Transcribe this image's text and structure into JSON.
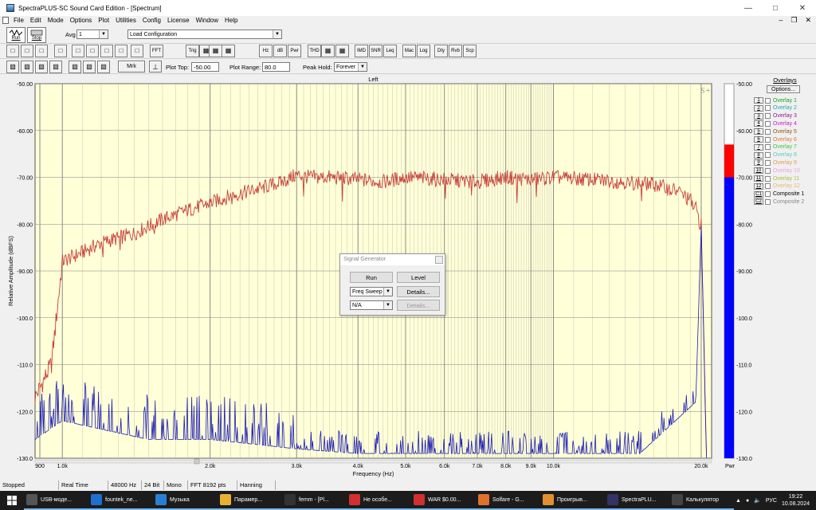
{
  "title": "SpectraPLUS-SC Sound Card Edition - [Spectrum]",
  "menu": [
    "File",
    "Edit",
    "Mode",
    "Options",
    "Plot",
    "Utilities",
    "Config",
    "License",
    "Window",
    "Help"
  ],
  "toolbar1": {
    "run": "Run",
    "stop": "Stop",
    "avg_label": "Avg",
    "avg_value": "1",
    "config_value": "Load Configuration"
  },
  "toolbar2": [
    "FFT",
    "Trig",
    "Hz",
    "dB",
    "Pwr",
    "THD",
    "IMD",
    "SNR",
    "Leq",
    "Mac",
    "Log",
    "Dty",
    "Rvb",
    "Scp"
  ],
  "toolbar3": {
    "mrk": "Mrk",
    "plot_top_label": "Plot Top:",
    "plot_top": "-50.00",
    "plot_range_label": "Plot Range:",
    "plot_range": "80.0",
    "peak_hold_label": "Peak Hold:",
    "peak_hold": "Forever"
  },
  "plot": {
    "title": "Left",
    "ylabel": "Relative Amplitude (dBFS)",
    "xlabel": "Frequency (Hz)",
    "logo": "S+",
    "bar_label": "Pwr",
    "yticks": [
      "-50.00",
      "-60.00",
      "-70.00",
      "-80.00",
      "-90.00",
      "-100.0",
      "-110.0",
      "-120.0",
      "-130.0"
    ],
    "ytick_values": [
      -50,
      -60,
      -70,
      -80,
      -90,
      -100,
      -110,
      -120,
      -130
    ],
    "xticks": [
      {
        "f": 900,
        "l": "900"
      },
      {
        "f": 1000,
        "l": "1.0k"
      },
      {
        "f": 2000,
        "l": "2.0k"
      },
      {
        "f": 3000,
        "l": "3.0k"
      },
      {
        "f": 4000,
        "l": "4.0k"
      },
      {
        "f": 5000,
        "l": "5.0k"
      },
      {
        "f": 6000,
        "l": "6.0k"
      },
      {
        "f": 7000,
        "l": "7.0k"
      },
      {
        "f": 8000,
        "l": "8.0k"
      },
      {
        "f": 9000,
        "l": "9.0k"
      },
      {
        "f": 10000,
        "l": "10.0k"
      },
      {
        "f": 20000,
        "l": "20.0k"
      }
    ],
    "colors": {
      "bg": "#ffffd8",
      "red": "#c8413a",
      "blue": "#1c1cb4",
      "grid": "#808080"
    },
    "bar_values": {
      "red_top": -63,
      "blue_top": -70
    }
  },
  "chart_data": {
    "type": "line",
    "title": "Left",
    "xlabel": "Frequency (Hz)",
    "ylabel": "Relative Amplitude (dBFS)",
    "xlim": [
      880,
      21000
    ],
    "ylim": [
      -130,
      -50
    ],
    "xscale": "log",
    "grid": true,
    "series": [
      {
        "x": [
          880,
          900,
          950,
          1000,
          1100,
          1200,
          1400,
          1600,
          1800,
          2000,
          2200,
          2500,
          2800,
          3000,
          3200,
          3500,
          4000,
          4500,
          5000,
          6000,
          7000,
          8000,
          9000,
          10000,
          12000,
          14000,
          16000,
          18000,
          19000,
          19500,
          20000,
          20500
        ],
        "y": [
          -117,
          -115,
          -110,
          -88,
          -86,
          -84,
          -82,
          -79,
          -77,
          -75.5,
          -74,
          -72.5,
          -71,
          -69.5,
          -70,
          -70,
          -70.5,
          -71,
          -70,
          -70.5,
          -71,
          -70,
          -70.5,
          -70,
          -70.5,
          -71,
          -71.5,
          -73,
          -75,
          -77,
          -80,
          -130
        ]
      },
      {
        "x": [
          880,
          1000,
          1500,
          2000,
          3000,
          4000,
          6000,
          8000,
          10000,
          15000,
          19500,
          20000,
          20500
        ],
        "y": [
          -126,
          -122,
          -126,
          -126,
          -128,
          -129,
          -129,
          -129,
          -129,
          -129,
          -118,
          -80,
          -130
        ]
      }
    ]
  },
  "dialog": {
    "title": "Signal Generator",
    "run": "Run",
    "level": "Level",
    "mode": "Freq Sweep",
    "details": "Details...",
    "na": "N/A"
  },
  "overlays": {
    "header": "Overlays",
    "options": "Options...",
    "items": [
      {
        "n": "1",
        "l": "Overlay 1",
        "c": "#1ea01e"
      },
      {
        "n": "2",
        "l": "Overlay 2",
        "c": "#29a8a8"
      },
      {
        "n": "3",
        "l": "Overlay 3",
        "c": "#8a1c8a"
      },
      {
        "n": "4",
        "l": "Overlay 4",
        "c": "#c81ec8"
      },
      {
        "n": "5",
        "l": "Overlay 5",
        "c": "#8a5a1c"
      },
      {
        "n": "6",
        "l": "Overlay 6",
        "c": "#e07a3a"
      },
      {
        "n": "7",
        "l": "Overlay 7",
        "c": "#3cc83c"
      },
      {
        "n": "8",
        "l": "Overlay 8",
        "c": "#5ac8c8"
      },
      {
        "n": "9",
        "l": "Overlay 9",
        "c": "#e0a050"
      },
      {
        "n": "10",
        "l": "Overlay 10",
        "c": "#f0a0e0"
      },
      {
        "n": "11",
        "l": "Overlay 11",
        "c": "#b0c040"
      },
      {
        "n": "12",
        "l": "Overlay 12",
        "c": "#e8b870"
      },
      {
        "n": "C1",
        "l": "Composite 1",
        "c": "#000000"
      },
      {
        "n": "C2",
        "l": "Composite 2",
        "c": "#888888"
      }
    ]
  },
  "status": [
    {
      "t": "Stopped",
      "w": 74
    },
    {
      "t": "Real Time",
      "w": 62
    },
    {
      "t": "48000 Hz",
      "w": 42
    },
    {
      "t": "24 Bit",
      "w": 28
    },
    {
      "t": "Mono",
      "w": 30
    },
    {
      "t": "FFT 8192 pts",
      "w": 62
    },
    {
      "t": "Hanning",
      "w": 48
    }
  ],
  "taskbar": [
    {
      "t": "USB-моде...",
      "c": "#555"
    },
    {
      "t": "fountek_ne...",
      "c": "#1e6fd0"
    },
    {
      "t": "Музыка",
      "c": "#2a7fd4"
    },
    {
      "t": "Парамер...",
      "c": "#e8b030"
    },
    {
      "t": "femm - [Pl...",
      "c": "#333"
    },
    {
      "t": "Не особе...",
      "c": "#d03030"
    },
    {
      "t": "WAR $0.00...",
      "c": "#d03030"
    },
    {
      "t": "Solfare - G...",
      "c": "#e07030"
    },
    {
      "t": "Проигрыв...",
      "c": "#e09030"
    },
    {
      "t": "SpectraPLU...",
      "c": "#336"
    },
    {
      "t": "Калькулятор",
      "c": "#444"
    }
  ],
  "tray": {
    "lang": "РУС",
    "time": "19:22",
    "date": "10.08.2024"
  }
}
